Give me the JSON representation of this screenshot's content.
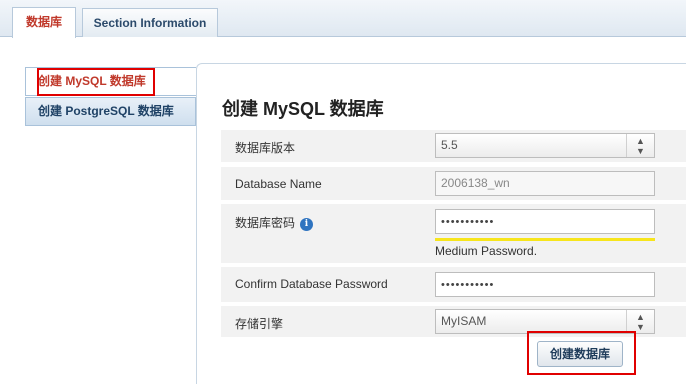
{
  "tabs": [
    {
      "label": "数据库"
    },
    {
      "label": "Section Information"
    }
  ],
  "sidebar": {
    "items": [
      {
        "label": "创建 MySQL 数据库"
      },
      {
        "label": "创建 PostgreSQL 数据库"
      }
    ]
  },
  "main": {
    "title": "创建 MySQL 数据库",
    "fields": {
      "version": {
        "label": "数据库版本",
        "value": "5.5"
      },
      "db_name": {
        "label": "Database Name",
        "value": "2006138_wn"
      },
      "password": {
        "label": "数据库密码",
        "value": "•••••••••••"
      },
      "strength": "Medium Password.",
      "confirm": {
        "label": "Confirm Database Password",
        "value": "•••••••••••"
      },
      "engine": {
        "label": "存储引擎",
        "value": "MyISAM"
      }
    },
    "submit_label": "创建数据库"
  },
  "colors": {
    "active_tab_text": "#c0392b",
    "highlight_box": "#e00000",
    "strength_bar": "#f7e51c",
    "info_icon": "#2f74c0"
  },
  "icons": {
    "info": "info-icon",
    "select_arrows": "up-down-arrows-icon"
  }
}
